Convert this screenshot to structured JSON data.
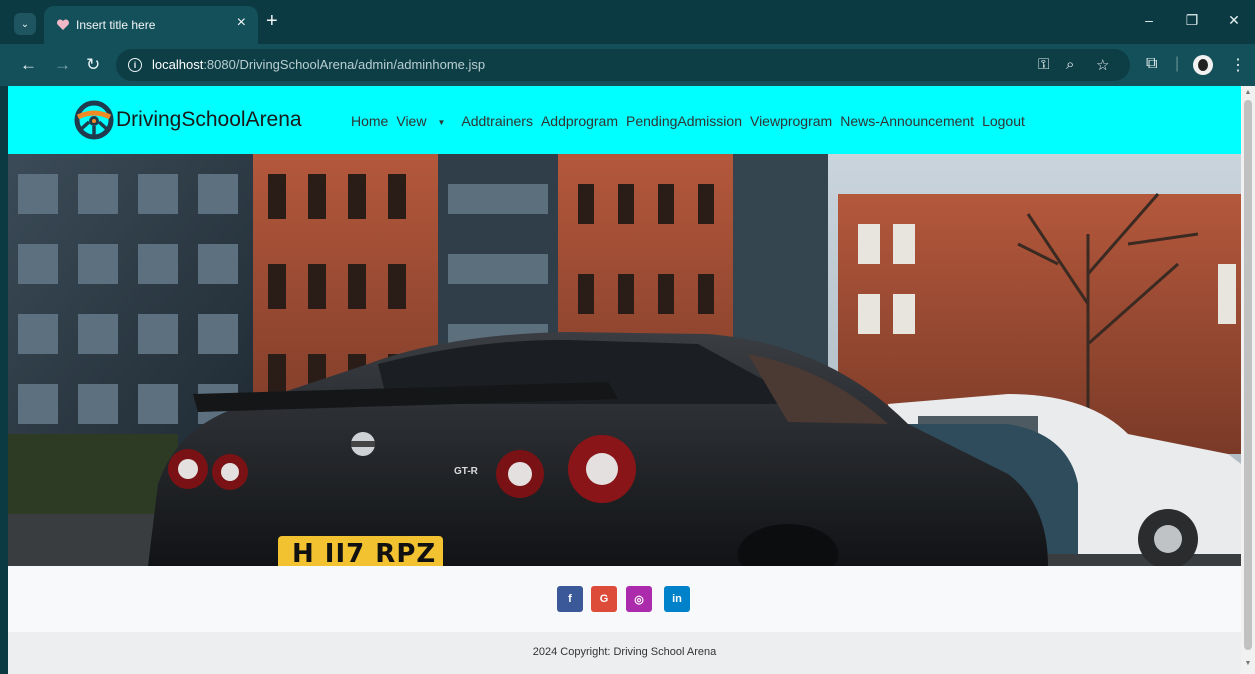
{
  "browser": {
    "tab_title": "Insert title here",
    "url_host": "localhost",
    "url_rest": ":8080/DrivingSchoolArena/admin/adminhome.jsp"
  },
  "site": {
    "brand": "DrivingSchoolArena",
    "nav": [
      "Home",
      "View",
      "Addtrainers",
      "Addprogram",
      "PendingAdmission",
      "Viewprogram",
      "News-Announcement",
      "Logout"
    ]
  },
  "hero": {
    "plate": "H II7 RPZ",
    "car_badge": "GT-R"
  },
  "social": {
    "facebook": "f",
    "google": "G",
    "instagram": "◎",
    "linkedin": "in"
  },
  "footer": {
    "copyright": "2024 Copyright: Driving School Arena"
  },
  "colors": {
    "navbar_bg": "#00ffff",
    "facebook": "#3b5998",
    "google": "#dd4b39",
    "instagram": "#ac2bac",
    "linkedin": "#0082ca"
  }
}
